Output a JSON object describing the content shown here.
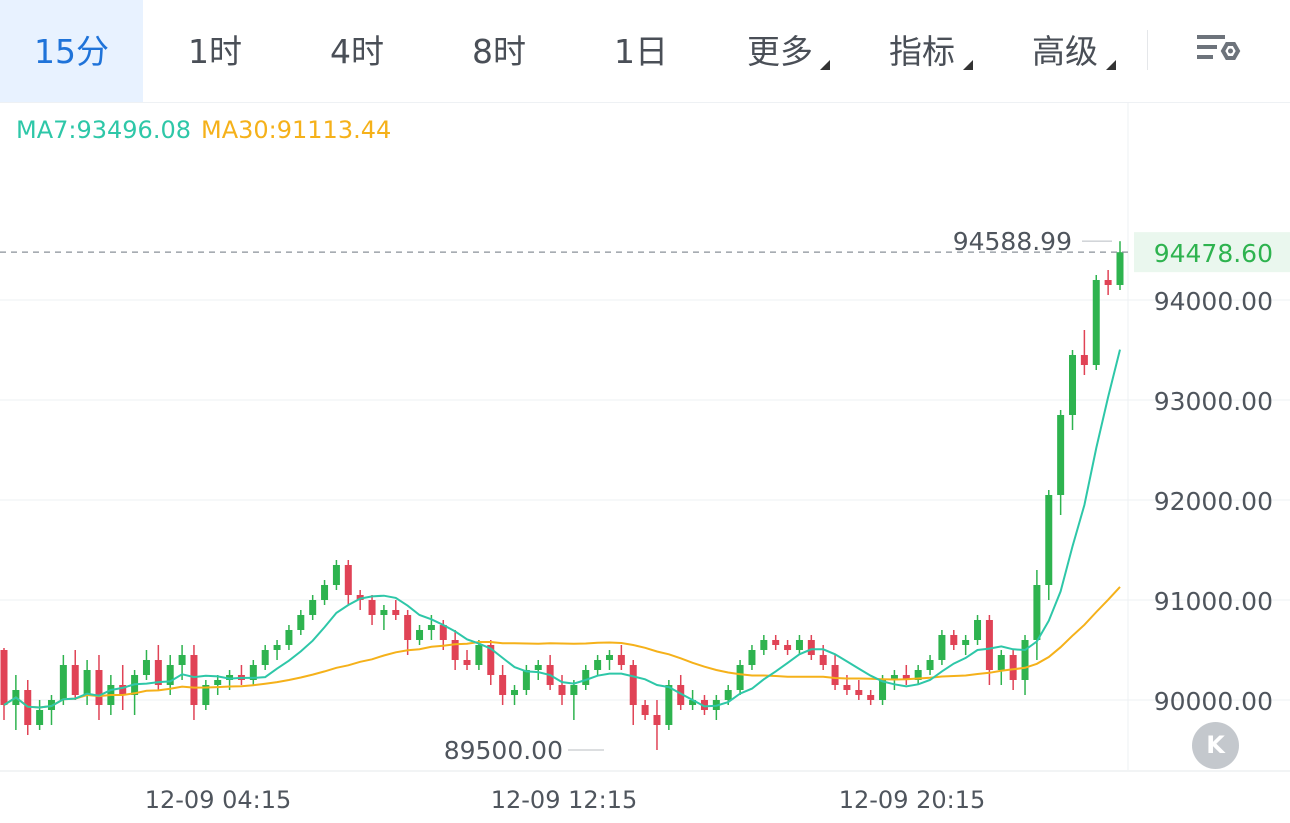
{
  "tabs": [
    {
      "label": "15分",
      "active": true
    },
    {
      "label": "1时"
    },
    {
      "label": "4时"
    },
    {
      "label": "8时"
    },
    {
      "label": "1日"
    },
    {
      "label": "更多",
      "dropdown": true
    },
    {
      "label": "指标",
      "dropdown": true
    },
    {
      "label": "高级",
      "dropdown": true
    }
  ],
  "settings_icon": "chart-settings-icon",
  "indicators": {
    "ma7": "MA7:93496.08",
    "ma30": "MA30:91113.44"
  },
  "colors": {
    "up": "#2eb34f",
    "down": "#e04356",
    "ma7": "#2ec7a8",
    "ma30": "#f5b11a",
    "active_tab": "#1f73d9",
    "price_tag_bg": "#eaf7ee"
  },
  "scroll_button_icon": "chevron-left-end-icon",
  "chart_data": {
    "type": "candlestick",
    "interval": "15分",
    "y_axis_labels": [
      "94000.00",
      "93000.00",
      "92000.00",
      "91000.00",
      "90000.00"
    ],
    "ylim": [
      89300,
      95400
    ],
    "x_axis_labels": [
      "12-09 04:15",
      "12-09 12:15",
      "12-09 20:15"
    ],
    "current_price": "94478.60",
    "high_label": "94588.99",
    "low_label": "89500.00",
    "candles_ohlc": [
      [
        90500,
        90520,
        89800,
        89950
      ],
      [
        89950,
        90250,
        89700,
        90100
      ],
      [
        90100,
        90200,
        89650,
        89750
      ],
      [
        89750,
        90000,
        89700,
        89900
      ],
      [
        89900,
        90050,
        89750,
        90000
      ],
      [
        90000,
        90450,
        89950,
        90350
      ],
      [
        90350,
        90500,
        90000,
        90050
      ],
      [
        90050,
        90400,
        89950,
        90300
      ],
      [
        90300,
        90450,
        89800,
        89950
      ],
      [
        89950,
        90250,
        89850,
        90150
      ],
      [
        90150,
        90350,
        89900,
        90050
      ],
      [
        90050,
        90300,
        89850,
        90250
      ],
      [
        90250,
        90500,
        90200,
        90400
      ],
      [
        90400,
        90550,
        90100,
        90150
      ],
      [
        90150,
        90450,
        90050,
        90350
      ],
      [
        90350,
        90550,
        90200,
        90450
      ],
      [
        90450,
        90550,
        89800,
        89950
      ],
      [
        89950,
        90200,
        89900,
        90150
      ],
      [
        90150,
        90250,
        90050,
        90200
      ],
      [
        90200,
        90300,
        90100,
        90250
      ],
      [
        90250,
        90350,
        90150,
        90200
      ],
      [
        90200,
        90400,
        90150,
        90350
      ],
      [
        90350,
        90550,
        90300,
        90500
      ],
      [
        90500,
        90600,
        90400,
        90550
      ],
      [
        90550,
        90750,
        90500,
        90700
      ],
      [
        90700,
        90900,
        90650,
        90850
      ],
      [
        90850,
        91050,
        90800,
        91000
      ],
      [
        91000,
        91200,
        90950,
        91150
      ],
      [
        91150,
        91400,
        91100,
        91350
      ],
      [
        91350,
        91400,
        90950,
        91050
      ],
      [
        91050,
        91100,
        90900,
        91000
      ],
      [
        91000,
        91050,
        90750,
        90850
      ],
      [
        90850,
        90950,
        90700,
        90900
      ],
      [
        90900,
        91000,
        90800,
        90850
      ],
      [
        90850,
        90900,
        90450,
        90600
      ],
      [
        90600,
        90750,
        90550,
        90700
      ],
      [
        90700,
        90850,
        90600,
        90750
      ],
      [
        90750,
        90800,
        90500,
        90600
      ],
      [
        90600,
        90700,
        90300,
        90400
      ],
      [
        90400,
        90500,
        90300,
        90350
      ],
      [
        90350,
        90600,
        90300,
        90550
      ],
      [
        90550,
        90600,
        90150,
        90250
      ],
      [
        90250,
        90350,
        89950,
        90050
      ],
      [
        90050,
        90150,
        89950,
        90100
      ],
      [
        90100,
        90350,
        90050,
        90300
      ],
      [
        90300,
        90400,
        90200,
        90350
      ],
      [
        90350,
        90450,
        90100,
        90150
      ],
      [
        90150,
        90250,
        89950,
        90050
      ],
      [
        90050,
        90200,
        89800,
        90150
      ],
      [
        90150,
        90350,
        90100,
        90300
      ],
      [
        90300,
        90450,
        90250,
        90400
      ],
      [
        90400,
        90500,
        90300,
        90450
      ],
      [
        90450,
        90550,
        90300,
        90350
      ],
      [
        90350,
        90400,
        89750,
        89950
      ],
      [
        89950,
        90000,
        89800,
        89850
      ],
      [
        89850,
        90000,
        89500,
        89750
      ],
      [
        89750,
        90200,
        89700,
        90150
      ],
      [
        90150,
        90250,
        89900,
        89950
      ],
      [
        89950,
        90100,
        89900,
        90000
      ],
      [
        90000,
        90050,
        89850,
        89900
      ],
      [
        89900,
        90050,
        89800,
        90000
      ],
      [
        90000,
        90150,
        89950,
        90100
      ],
      [
        90100,
        90400,
        90050,
        90350
      ],
      [
        90350,
        90550,
        90300,
        90500
      ],
      [
        90500,
        90650,
        90450,
        90600
      ],
      [
        90600,
        90650,
        90500,
        90550
      ],
      [
        90550,
        90600,
        90450,
        90500
      ],
      [
        90500,
        90650,
        90450,
        90600
      ],
      [
        90600,
        90650,
        90400,
        90450
      ],
      [
        90450,
        90550,
        90300,
        90350
      ],
      [
        90350,
        90450,
        90100,
        90150
      ],
      [
        90150,
        90250,
        90050,
        90100
      ],
      [
        90100,
        90200,
        90000,
        90050
      ],
      [
        90050,
        90100,
        89950,
        90000
      ],
      [
        90000,
        90250,
        89950,
        90200
      ],
      [
        90200,
        90300,
        90100,
        90250
      ],
      [
        90250,
        90350,
        90150,
        90200
      ],
      [
        90200,
        90350,
        90150,
        90300
      ],
      [
        90300,
        90450,
        90250,
        90400
      ],
      [
        90400,
        90700,
        90350,
        90650
      ],
      [
        90650,
        90700,
        90500,
        90550
      ],
      [
        90550,
        90650,
        90450,
        90600
      ],
      [
        90600,
        90850,
        90550,
        90800
      ],
      [
        90800,
        90850,
        90150,
        90300
      ],
      [
        90300,
        90500,
        90150,
        90450
      ],
      [
        90450,
        90500,
        90100,
        90200
      ],
      [
        90200,
        90650,
        90050,
        90600
      ],
      [
        90600,
        91300,
        90400,
        91150
      ],
      [
        91150,
        92100,
        91000,
        92050
      ],
      [
        92050,
        92900,
        91850,
        92850
      ],
      [
        92850,
        93500,
        92700,
        93450
      ],
      [
        93450,
        93700,
        93250,
        93350
      ],
      [
        93350,
        94250,
        93300,
        94200
      ],
      [
        94200,
        94300,
        94050,
        94150
      ],
      [
        94150,
        94588,
        94100,
        94478
      ]
    ]
  }
}
